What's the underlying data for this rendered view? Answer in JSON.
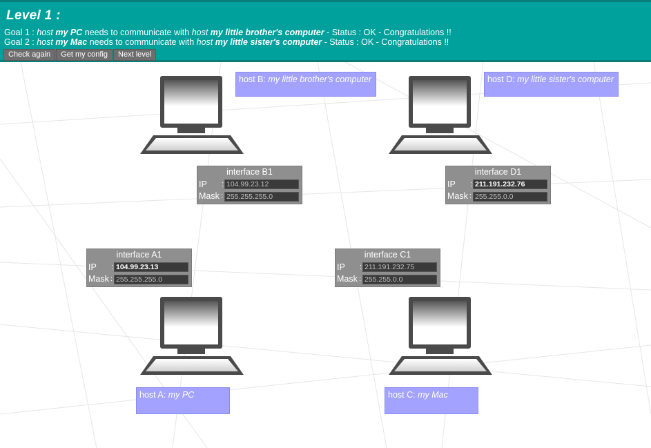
{
  "level_title": "Level 1 :",
  "goals": [
    {
      "prefix": "Goal 1 : ",
      "host_word1": "host ",
      "host1": "my PC",
      "mid": " needs to communicate with ",
      "host_word2": "host ",
      "host2": "my little brother's computer",
      "status": " - Status : OK - Congratulations !!"
    },
    {
      "prefix": "Goal 2 : ",
      "host_word1": "host ",
      "host1": "my Mac",
      "mid": " needs to communicate with ",
      "host_word2": "host ",
      "host2": "my little sister's computer",
      "status": " - Status : OK - Congratulations !!"
    }
  ],
  "buttons": {
    "check": "Check again",
    "config": "Get my config",
    "next": "Next level"
  },
  "hosts": {
    "A": {
      "prefix": "host A: ",
      "name": "my PC"
    },
    "B": {
      "prefix": "host B: ",
      "name": "my little brother's computer"
    },
    "C": {
      "prefix": "host C: ",
      "name": "my Mac"
    },
    "D": {
      "prefix": "host D: ",
      "name": "my little sister's computer"
    }
  },
  "interfaces": {
    "A1": {
      "title": "interface A1",
      "ip_label": "IP",
      "mask_label": "Mask",
      "ip": "104.99.23.13",
      "mask": "255.255.255.0"
    },
    "B1": {
      "title": "interface B1",
      "ip_label": "IP",
      "mask_label": "Mask",
      "ip": "104.99.23.12",
      "mask": "255.255.255.0"
    },
    "C1": {
      "title": "interface C1",
      "ip_label": "IP",
      "mask_label": "Mask",
      "ip": "211.191.232.75",
      "mask": "255.255.0.0"
    },
    "D1": {
      "title": "interface D1",
      "ip_label": "IP",
      "mask_label": "Mask",
      "ip": "211.191.232.76",
      "mask": "255.255.0.0"
    }
  },
  "colors": {
    "header": "#00a19c",
    "host_label": "#a3a3ff",
    "interface": "#8f8f8f",
    "button": "#6e6e6e"
  }
}
